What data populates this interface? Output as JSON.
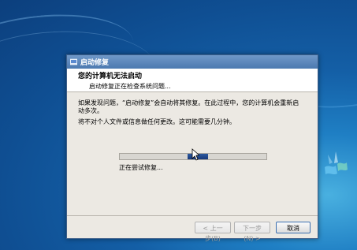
{
  "window": {
    "title": "启动修复",
    "header_title": "您的计算机无法启动",
    "header_subtitle": "启动修复正在检查系统问题..."
  },
  "content": {
    "paragraph1": "如果发现问题，“启动修复”会自动将其修复。在此过程中，您的计算机会重新启动多次。",
    "paragraph2": "将不对个人文件或信息做任何更改。这可能需要几分钟。",
    "status_text": "正在尝试修复..."
  },
  "progress": {
    "fraction_start": 0.46,
    "fraction_width": 0.14,
    "indeterminate": true
  },
  "buttons": {
    "back": "< 上一步(B)",
    "next": "下一步(N) >",
    "cancel": "取消"
  },
  "colors": {
    "desktop_bg": "#145fa6",
    "title_bar": "#4c79b0",
    "progress_fill": "#17387a"
  },
  "icons": {
    "title": "repair-icon",
    "desktop_logo": "windows-logo-icon"
  }
}
